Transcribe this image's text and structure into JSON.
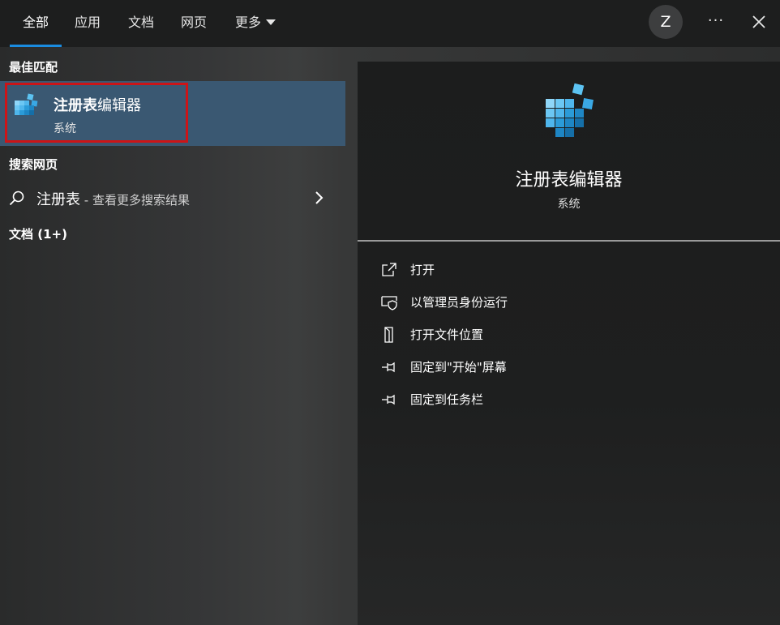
{
  "tabs": [
    {
      "label": "全部"
    },
    {
      "label": "应用"
    },
    {
      "label": "文档"
    },
    {
      "label": "网页"
    },
    {
      "label": "更多"
    }
  ],
  "user": {
    "avatar_letter": "Z"
  },
  "toolbar": {
    "more_options": "···"
  },
  "left": {
    "best_match_heading": "最佳匹配",
    "best_match": {
      "title_bold": "注册表",
      "title_rest": "编辑器",
      "subtitle": "系统"
    },
    "web_heading": "搜索网页",
    "web_result": {
      "query": "注册表",
      "hint": " - 查看更多搜索结果"
    },
    "docs_heading": "文档 (1+)"
  },
  "right": {
    "title": "注册表编辑器",
    "subtitle": "系统",
    "actions": [
      {
        "label": "打开",
        "icon": "open-icon"
      },
      {
        "label": "以管理员身份运行",
        "icon": "shield-admin-icon"
      },
      {
        "label": "打开文件位置",
        "icon": "file-location-icon"
      },
      {
        "label": "固定到\"开始\"屏幕",
        "icon": "pin-icon"
      },
      {
        "label": "固定到任务栏",
        "icon": "pin-icon"
      }
    ]
  },
  "colors": {
    "accent": "#1a8ce0",
    "selection": "#3a5872",
    "highlight_border": "#cc1417"
  }
}
